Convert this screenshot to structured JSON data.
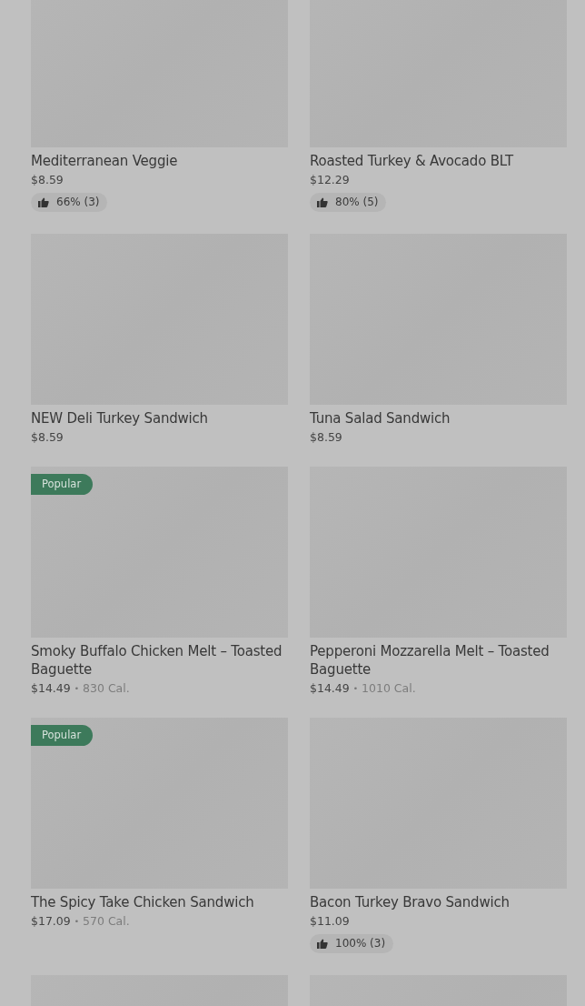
{
  "items": [
    {
      "kind": "full",
      "title": "Mediterranean Veggie",
      "price": "$8.59",
      "rating": "66% (3)"
    },
    {
      "kind": "full",
      "title": "Roasted Turkey & Avocado BLT",
      "price": "$12.29",
      "rating": "80% (5)"
    },
    {
      "kind": "full",
      "title": "NEW Deli Turkey Sandwich",
      "price": "$8.59"
    },
    {
      "kind": "full",
      "title": "Tuna Salad Sandwich",
      "price": "$8.59"
    },
    {
      "kind": "full",
      "badge": "Popular",
      "title": "Smoky Buffalo Chicken Melt – Toasted Baguette",
      "price": "$14.49",
      "separator": "•",
      "calories": "830 Cal."
    },
    {
      "kind": "full",
      "title": "Pepperoni Mozzarella Melt – Toasted Baguette",
      "price": "$14.49",
      "separator": "•",
      "calories": "1010 Cal."
    },
    {
      "kind": "full",
      "badge": "Popular",
      "title": "The Spicy Take Chicken Sandwich",
      "price": "$17.09",
      "separator": "•",
      "calories": "570 Cal."
    },
    {
      "kind": "full",
      "title": "Bacon Turkey Bravo Sandwich",
      "price": "$11.09",
      "rating": "100% (3)"
    },
    {
      "kind": "image-only"
    },
    {
      "kind": "image-only"
    }
  ]
}
